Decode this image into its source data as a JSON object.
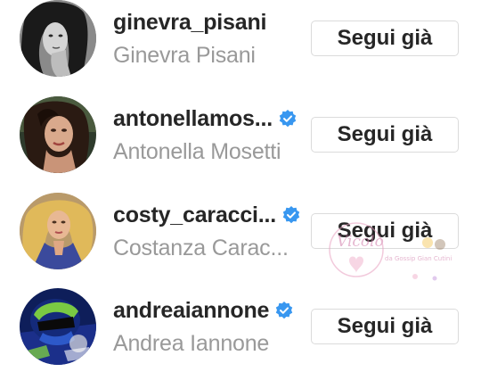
{
  "follow_list": {
    "items": [
      {
        "username": "ginevra_pisani",
        "full_name": "Ginevra Pisani",
        "verified": false,
        "button_label": "Segui già",
        "avatar": "profile-photo-grayscale"
      },
      {
        "username": "antonellamos...",
        "full_name": "Antonella Mosetti",
        "verified": true,
        "button_label": "Segui già",
        "avatar": "profile-photo-dark-hair"
      },
      {
        "username": "costy_caracci...",
        "full_name": "Costanza Carac...",
        "verified": true,
        "button_label": "Segui già",
        "avatar": "profile-photo-blonde"
      },
      {
        "username": "andreaiannone",
        "full_name": "Andrea Iannone",
        "verified": true,
        "button_label": "Segui già",
        "avatar": "profile-photo-motorcycle-helmet"
      }
    ]
  },
  "colors": {
    "username": "#262626",
    "full_name": "#999999",
    "verified_badge": "#3897f0",
    "button_border": "#dbdbdb",
    "background": "#ffffff"
  },
  "watermark": {
    "script_text": "Vicolo",
    "site_text": "da Gossip Gian Cutini",
    "icon": "pink-heart-logo"
  }
}
